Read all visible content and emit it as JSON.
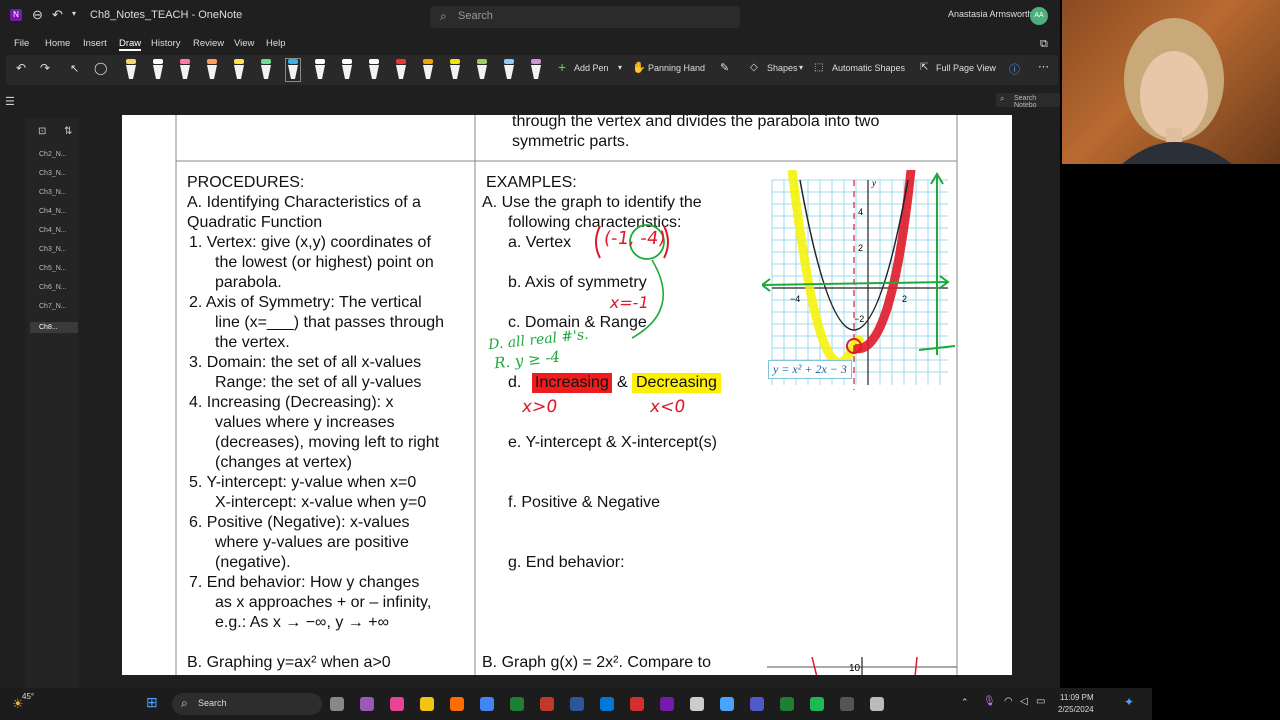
{
  "titlebar": {
    "doc_title": "Ch8_Notes_TEACH",
    "app": "OneNote",
    "search_placeholder": "Search",
    "user": "Anastasia Armsworth",
    "user_initials": "AA"
  },
  "menu": [
    "File",
    "Home",
    "Insert",
    "Draw",
    "History",
    "Review",
    "View",
    "Help"
  ],
  "ribbon": {
    "add_pen": "Add Pen",
    "panning_hand": "Panning Hand",
    "shapes": "Shapes",
    "automatic_shapes": "Automatic Shapes",
    "full_page_view": "Full Page View",
    "search_notebook": "Search Notebo"
  },
  "pen_colors": [
    "#f5d76e",
    "#ffffff",
    "#ff7aa2",
    "#ff9f5a",
    "#ffe14d",
    "#6fdc8c",
    "#3ab0e2",
    "#ffffff",
    "#ffffff",
    "#ffffff",
    "#e53935",
    "#f4a300",
    "#f2e600",
    "#9ccc65",
    "#90caf9",
    "#ce93d8"
  ],
  "sidebar_pages": [
    "Ch2_N...",
    "Ch3_N...",
    "Ch3_N...",
    "Ch4_N...",
    "Ch4_N...",
    "Ch3_N...",
    "Ch5_N...",
    "Ch6_N...",
    "Ch7_N...",
    "Ch8..."
  ],
  "note": {
    "top_text_1": "through the vertex and divides the parabola into two",
    "top_text_2": "symmetric parts.",
    "procedures_header": "PROCEDURES:",
    "proc_a_1": "A. Identifying Characteristics of a",
    "proc_a_2": "Quadratic Function",
    "p1_1": "1.   Vertex: give (x,y) coordinates of",
    "p1_2": "the lowest (or highest) point on",
    "p1_3": "parabola.",
    "p2_1": "2.   Axis of Symmetry: The vertical",
    "p2_2": "line (x=___) that passes through",
    "p2_3": "the vertex.",
    "p3_1": "3.   Domain: the set of all x-values",
    "p3_2": "Range: the set of all y-values",
    "p4_1": "4.   Increasing (Decreasing): x",
    "p4_2": "values where y increases",
    "p4_3": "(decreases), moving left to right",
    "p4_4": "(changes at vertex)",
    "p5_1": "5.   Y-intercept: y-value when x=0",
    "p5_2": "X-intercept: x-value when y=0",
    "p6_1": "6.   Positive (Negative): x-values",
    "p6_2": "where y-values are positive",
    "p6_3": "(negative).",
    "p7_1": "7.   End behavior: How y changes",
    "p7_2": "as x approaches + or – infinity,",
    "p7_3": "e.g.: As x → −∞, y → +∞",
    "proc_b": "B. Graphing y=ax² when a>0",
    "examples_header": "EXAMPLES:",
    "ex_a_1": "A.   Use the graph to identify the",
    "ex_a_2": "following characteristics:",
    "ex_a": "a.   Vertex",
    "ex_b": "b.   Axis of symmetry",
    "ex_c": "c.   Domain & Range",
    "ex_d_prefix": "d.",
    "ex_d_inc": "Increasing",
    "ex_d_amp": " & ",
    "ex_d_dec": "Decreasing",
    "ex_e": "e.   Y-intercept & X-intercept(s)",
    "ex_f": "f.    Positive & Negative",
    "ex_g": "g.   End behavior:",
    "ex_b2": "B.   Graph g(x) = 2x². Compare to",
    "graph_label": "y = x² + 2x − 3",
    "graph_ticks": [
      "4",
      "2",
      "−4",
      "2",
      "−2"
    ],
    "graph_y_label": "y",
    "bottom_tick": "10"
  },
  "ink": {
    "vertex": "(-1, -4)",
    "axis": "x=-1",
    "domain": "D. all real #'s.",
    "range": "R.   y ≥ -4",
    "increasing": "x>0",
    "decreasing": "x<0"
  },
  "taskbar": {
    "weather": "45°",
    "search": "Search",
    "time": "11:09 PM",
    "date": "2/25/2024"
  },
  "colors": {
    "accent_app": "#7719aa",
    "ink_red": "#e0192a",
    "ink_green": "#1fa83c",
    "highlight_red": "#ee1c1c",
    "highlight_yellow": "#ffef00"
  }
}
